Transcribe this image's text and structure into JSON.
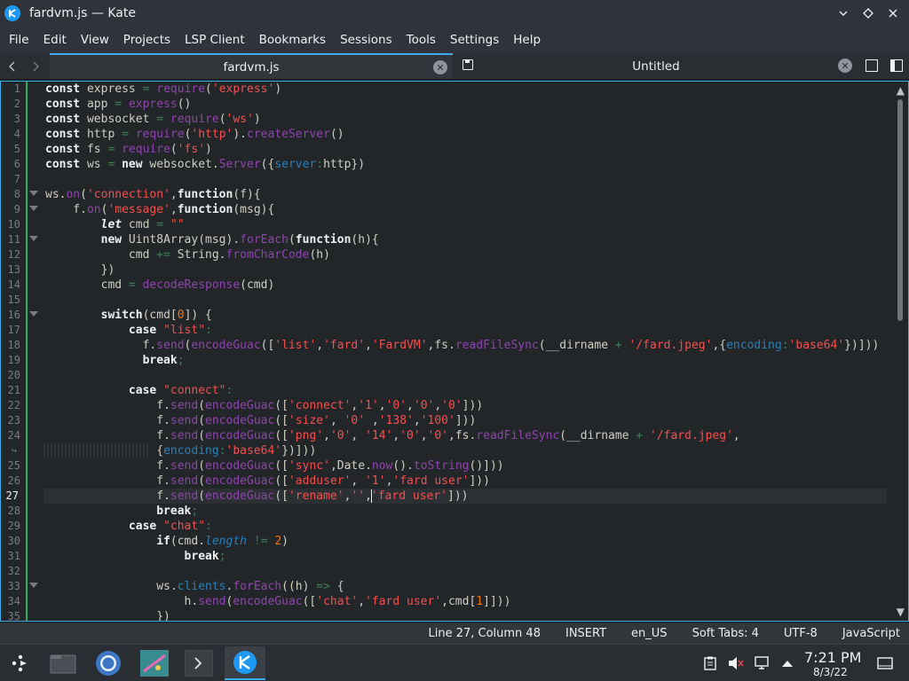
{
  "window": {
    "title": "fardvm.js — Kate"
  },
  "menu": [
    "File",
    "Edit",
    "View",
    "Projects",
    "LSP Client",
    "Bookmarks",
    "Sessions",
    "Tools",
    "Settings",
    "Help"
  ],
  "tabs": [
    {
      "label": "fardvm.js",
      "active": true
    },
    {
      "label": "Untitled",
      "active": false
    }
  ],
  "editor": {
    "current_line": 27,
    "lines": [
      {
        "n": "1",
        "html": "<span class='kw'>const</span> express <span class='op'>=</span> <span class='fn'>require</span>(<span class='str'>'express'</span>)"
      },
      {
        "n": "2",
        "html": "<span class='kw'>const</span> app <span class='op'>=</span> <span class='fn'>express</span>()"
      },
      {
        "n": "3",
        "html": "<span class='kw'>const</span> websocket <span class='op'>=</span> <span class='fn'>require</span>(<span class='str'>'ws'</span>)"
      },
      {
        "n": "4",
        "html": "<span class='kw'>const</span> http <span class='op'>=</span> <span class='fn'>require</span>(<span class='str'>'http'</span>).<span class='fn'>createServer</span>()"
      },
      {
        "n": "5",
        "html": "<span class='kw'>const</span> fs <span class='op'>=</span> <span class='fn'>require</span>(<span class='str'>'fs'</span>)"
      },
      {
        "n": "6",
        "html": "<span class='kw'>const</span> ws <span class='op'>=</span> <span class='kw'>new</span> websocket.<span class='fn'>Server</span>({<span class='prop'>server</span><span class='op'>:</span>http})"
      },
      {
        "n": "7",
        "html": ""
      },
      {
        "n": "8",
        "fold": true,
        "html": "ws.<span class='fn'>on</span>(<span class='str'>'connection'</span>,<span class='kw'>function</span>(f){"
      },
      {
        "n": "9",
        "fold": true,
        "html": "    f.<span class='fn'>on</span>(<span class='str'>'message'</span>,<span class='kw'>function</span>(msg){"
      },
      {
        "n": "10",
        "html": "        <span class='kwi'>let</span> cmd <span class='op'>=</span> <span class='str'>\"\"</span>"
      },
      {
        "n": "11",
        "fold": true,
        "html": "        <span class='kw'>new</span> Uint8Array(msg).<span class='fn'>forEach</span>(<span class='kw'>function</span>(h){"
      },
      {
        "n": "12",
        "html": "            cmd <span class='op'>+=</span> String.<span class='fn'>fromCharCode</span>(h)"
      },
      {
        "n": "13",
        "html": "        })"
      },
      {
        "n": "14",
        "html": "        cmd <span class='op'>=</span> <span class='fn'>decodeResponse</span>(cmd)"
      },
      {
        "n": "15",
        "html": ""
      },
      {
        "n": "16",
        "fold": true,
        "html": "        <span class='kw'>switch</span>(cmd[<span class='num'>0</span>]) {"
      },
      {
        "n": "17",
        "html": "            <span class='kw'>case</span> <span class='str'>\"list\"</span><span class='op'>:</span>"
      },
      {
        "n": "18",
        "html": "              f.<span class='fn'>send</span>(<span class='fn'>encodeGuac</span>([<span class='str'>'list'</span>,<span class='str'>'fard'</span>,<span class='str'>'FardVM'</span>,fs.<span class='fn'>readFileSync</span>(__dirname <span class='op'>+</span> <span class='str'>'/fard.jpeg'</span>,{<span class='prop'>encoding</span><span class='op'>:</span><span class='str'>'base64'</span>})]))"
      },
      {
        "n": "19",
        "html": "              <span class='kw'>break</span><span class='op'>;</span>"
      },
      {
        "n": "20",
        "html": ""
      },
      {
        "n": "21",
        "html": "            <span class='kw'>case</span> <span class='str'>\"connect\"</span><span class='op'>:</span>"
      },
      {
        "n": "22",
        "html": "                f.<span class='fn'>send</span>(<span class='fn'>encodeGuac</span>([<span class='str'>'connect'</span>,<span class='str'>'1'</span>,<span class='str'>'0'</span>,<span class='str'>'0'</span>,<span class='str'>'0'</span>]))"
      },
      {
        "n": "23",
        "html": "                f.<span class='fn'>send</span>(<span class='fn'>encodeGuac</span>([<span class='str'>'size'</span>, <span class='str'>'0'</span> ,<span class='str'>'138'</span>,<span class='str'>'100'</span>]))"
      },
      {
        "n": "24",
        "html": "                f.<span class='fn'>send</span>(<span class='fn'>encodeGuac</span>([<span class='str'>'png'</span>,<span class='str'>'0'</span>, <span class='str'>'14'</span>,<span class='str'>'0'</span>,<span class='str'>'0'</span>,fs.<span class='fn'>readFileSync</span>(__dirname <span class='op'>+</span> <span class='str'>'/fard.jpeg'</span>,",
        "wrap": false
      },
      {
        "n": "",
        "wrap": true,
        "html": "                {<span class='prop'>encoding</span><span class='op'>:</span><span class='str'>'base64'</span>})]))"
      },
      {
        "n": "25",
        "html": "                f.<span class='fn'>send</span>(<span class='fn'>encodeGuac</span>([<span class='str'>'sync'</span>,Date.<span class='fn'>now</span>().<span class='fn'>toString</span>()]))"
      },
      {
        "n": "26",
        "html": "                f.<span class='fn'>send</span>(<span class='fn'>encodeGuac</span>([<span class='str'>'adduser'</span>, <span class='str'>'1'</span>,<span class='str'>'fard user'</span>]))"
      },
      {
        "n": "27",
        "cur": true,
        "html": "                f.<span class='fn'>send</span>(<span class='fn'>encodeGuac</span>([<span class='str'>'rename'</span>,<span class='str'>''</span>,<span class='cursor'></span><span class='str'>'fard user'</span>]))"
      },
      {
        "n": "28",
        "html": "                <span class='kw'>break</span><span class='op'>;</span>"
      },
      {
        "n": "29",
        "html": "            <span class='kw'>case</span> <span class='str'>\"chat\"</span><span class='op'>:</span>"
      },
      {
        "n": "30",
        "html": "                <span class='kw'>if</span>(cmd.<span class='it'>length</span> <span class='op'>!=</span> <span class='num'>2</span>)"
      },
      {
        "n": "31",
        "html": "                    <span class='kw'>break</span><span class='op'>;</span>"
      },
      {
        "n": "32",
        "html": ""
      },
      {
        "n": "33",
        "fold": true,
        "html": "                ws.<span class='prop'>clients</span>.<span class='fn'>forEach</span>((h) <span class='op'>=></span> {"
      },
      {
        "n": "34",
        "html": "                    h.<span class='fn'>send</span>(<span class='fn'>encodeGuac</span>([<span class='str'>'chat'</span>,<span class='str'>'fard user'</span>,cmd[<span class='num'>1</span>]]))"
      },
      {
        "n": "35",
        "html": "                })"
      }
    ]
  },
  "status": {
    "position": "Line 27, Column 48",
    "mode": "INSERT",
    "language_dict": "en_US",
    "indent": "Soft Tabs: 4",
    "encoding": "UTF-8",
    "syntax": "JavaScript"
  },
  "taskbar": {
    "time": "7:21 PM",
    "date": "8/3/22"
  },
  "colors": {
    "accent": "#3daee9",
    "modified_bar": "#27ae60"
  }
}
